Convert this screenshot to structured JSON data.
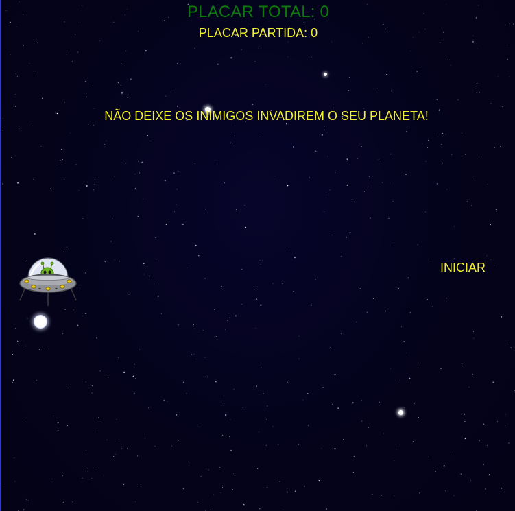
{
  "hud": {
    "score_total": "PLACAR TOTAL: 0",
    "score_match": "PLACAR PARTIDA: 0"
  },
  "message": {
    "mission": "NÃO DEIXE OS INIMIGOS INVADIREM O SEU PLANETA!"
  },
  "controls": {
    "start_label": "INICIAR"
  },
  "colors": {
    "background": "#05031a",
    "score_total": "#0d7a0d",
    "text_yellow": "#f2f02a"
  },
  "sprites": {
    "player": "alien-ufo-icon",
    "projectile": "energy-orb"
  }
}
